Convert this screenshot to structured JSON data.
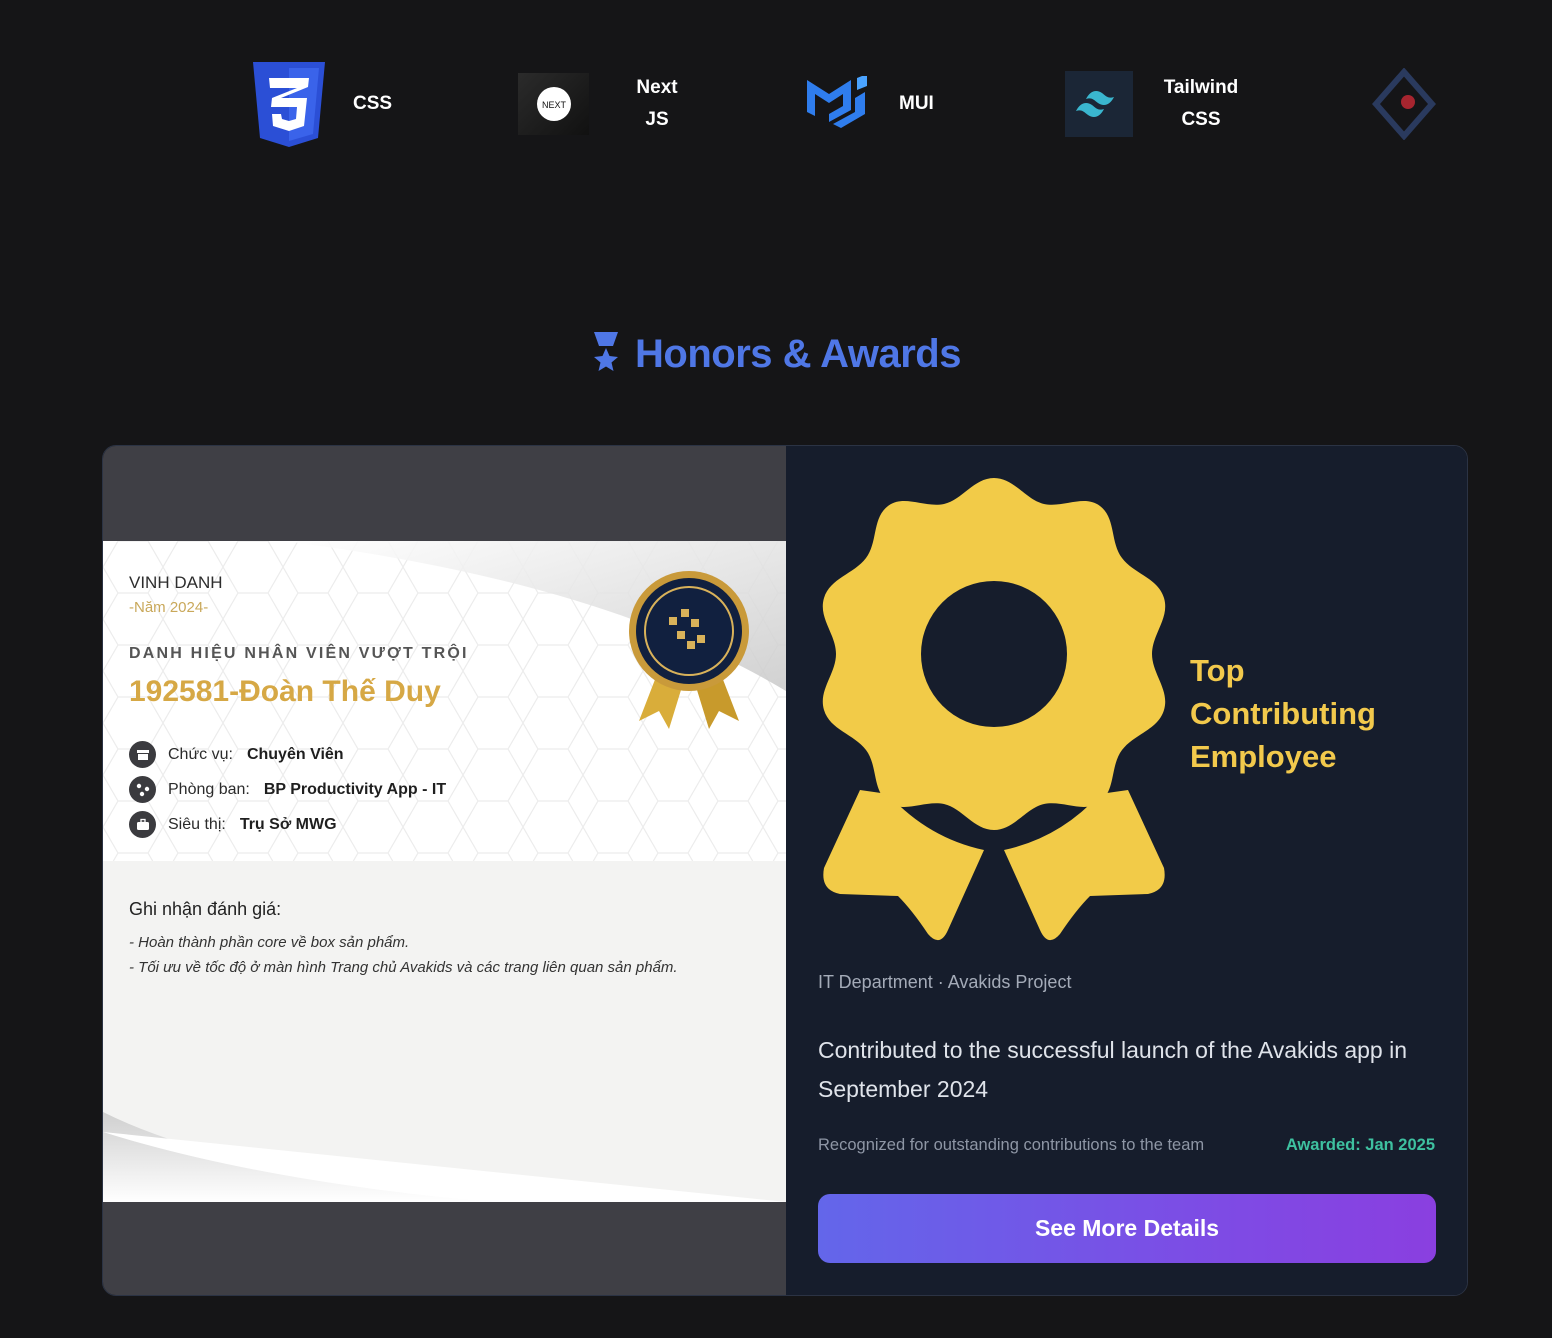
{
  "tech_stack": [
    {
      "label": "CSS",
      "icon": "css3-logo-icon"
    },
    {
      "label": "Next\nJS",
      "icon": "nextjs-logo-icon"
    },
    {
      "label": "MUI",
      "icon": "mui-logo-icon"
    },
    {
      "label": "Tailwind\nCSS",
      "icon": "tailwind-logo-icon"
    },
    {
      "label": "",
      "icon": "partial-logo-icon"
    }
  ],
  "section": {
    "icon": "award-medal-icon",
    "title": "Honors & Awards"
  },
  "certificate": {
    "heading": "VINH DANH",
    "year": "-Năm 2024-",
    "award_name": "DANH HIỆU NHÂN VIÊN VƯỢT TRỘI",
    "employee": "192581-Đoàn Thế Duy",
    "rows": [
      {
        "label": "Chức vụ:",
        "value": "Chuyên Viên",
        "icon": "store-icon"
      },
      {
        "label": "Phòng ban:",
        "value": "BP Productivity App - IT",
        "icon": "org-chart-icon"
      },
      {
        "label": "Siêu thị:",
        "value": "Trụ Sở MWG",
        "icon": "briefcase-icon"
      }
    ],
    "evaluation_title": "Ghi nhận đánh giá:",
    "evaluation_lines": [
      "- Hoàn thành phần core về box sản phẩm.",
      "- Tối ưu về tốc độ ở màn hình Trang chủ Avakids và các trang liên quan sản phẩm."
    ],
    "badge_icon": "gold-medal-badge-icon"
  },
  "award": {
    "icon": "award-ribbon-icon",
    "title": "Top\nContributing\nEmployee",
    "department": "IT Department · Avakids Project",
    "description": "Contributed to the successful launch of the Avakids app in September 2024",
    "note": "Recognized for outstanding contributions to the team",
    "date": "Awarded: Jan 2025",
    "button_label": "See More Details"
  },
  "colors": {
    "background": "#151517",
    "heading_blue": "#4f77e6",
    "award_gold": "#f2c94c",
    "awarded_green": "#3ec1a0",
    "button_gradient_start": "#6366ea",
    "button_gradient_end": "#8a3fe0"
  }
}
